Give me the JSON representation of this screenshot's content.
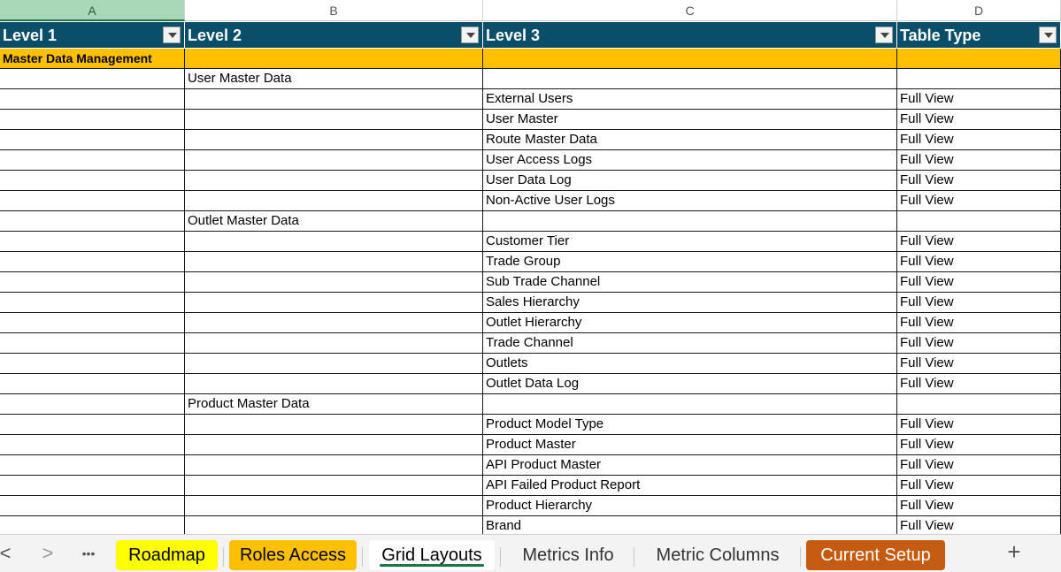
{
  "columns": [
    "A",
    "B",
    "C",
    "D"
  ],
  "headers": [
    "Level 1",
    "Level 2",
    "Level 3",
    "Table Type"
  ],
  "rows": [
    {
      "kind": "group",
      "cells": [
        "Master Data Management",
        "",
        "",
        ""
      ]
    },
    {
      "kind": "data",
      "cells": [
        "",
        "User Master Data",
        "",
        ""
      ]
    },
    {
      "kind": "data",
      "cells": [
        "",
        "",
        "External Users",
        "Full View"
      ]
    },
    {
      "kind": "data",
      "cells": [
        "",
        "",
        "User Master",
        "Full View"
      ]
    },
    {
      "kind": "data",
      "cells": [
        "",
        "",
        "Route Master Data",
        "Full View"
      ]
    },
    {
      "kind": "data",
      "cells": [
        "",
        "",
        "User Access Logs",
        "Full View"
      ]
    },
    {
      "kind": "data",
      "cells": [
        "",
        "",
        "User Data Log",
        "Full View"
      ]
    },
    {
      "kind": "data",
      "cells": [
        "",
        "",
        "Non-Active User Logs",
        "Full View"
      ]
    },
    {
      "kind": "data",
      "cells": [
        "",
        "Outlet Master Data",
        "",
        ""
      ]
    },
    {
      "kind": "data",
      "cells": [
        "",
        "",
        "Customer Tier",
        "Full View"
      ]
    },
    {
      "kind": "data",
      "cells": [
        "",
        "",
        "Trade Group",
        "Full View"
      ]
    },
    {
      "kind": "data",
      "cells": [
        "",
        "",
        "Sub Trade Channel",
        "Full View"
      ]
    },
    {
      "kind": "data",
      "cells": [
        "",
        "",
        "Sales Hierarchy",
        "Full View"
      ]
    },
    {
      "kind": "data",
      "cells": [
        "",
        "",
        "Outlet Hierarchy",
        "Full View"
      ]
    },
    {
      "kind": "data",
      "cells": [
        "",
        "",
        "Trade Channel",
        "Full View"
      ]
    },
    {
      "kind": "data",
      "cells": [
        "",
        "",
        "Outlets",
        "Full View"
      ]
    },
    {
      "kind": "data",
      "cells": [
        "",
        "",
        "Outlet Data Log",
        "Full View"
      ]
    },
    {
      "kind": "data",
      "cells": [
        "",
        "Product Master Data",
        "",
        ""
      ]
    },
    {
      "kind": "data",
      "cells": [
        "",
        "",
        "Product Model Type",
        "Full View"
      ]
    },
    {
      "kind": "data",
      "cells": [
        "",
        "",
        "Product Master",
        "Full View"
      ]
    },
    {
      "kind": "data",
      "cells": [
        "",
        "",
        "API Product Master",
        "Full View"
      ]
    },
    {
      "kind": "data",
      "cells": [
        "",
        "",
        "API Failed Product Report",
        "Full View"
      ]
    },
    {
      "kind": "data",
      "cells": [
        "",
        "",
        "Product Hierarchy",
        "Full View"
      ]
    },
    {
      "kind": "data",
      "cells": [
        "",
        "",
        "Brand",
        "Full View"
      ]
    }
  ],
  "tabs": [
    {
      "label": "Roadmap",
      "color": "#ffff00",
      "text": "#000000",
      "active": false
    },
    {
      "label": "Roles Access",
      "color": "#ffc000",
      "text": "#000000",
      "active": false
    },
    {
      "label": "Grid Layouts",
      "color": "#ffffff",
      "text": "#000000",
      "active": true
    },
    {
      "label": "Metrics Info",
      "color": "",
      "text": "#333333",
      "active": false
    },
    {
      "label": "Metric Columns",
      "color": "",
      "text": "#333333",
      "active": false
    },
    {
      "label": "Current Setup",
      "color": "#c55a11",
      "text": "#ffffff",
      "active": false
    }
  ],
  "nav": {
    "prev": "<",
    "next": ">",
    "more": "•••",
    "add": "+"
  }
}
